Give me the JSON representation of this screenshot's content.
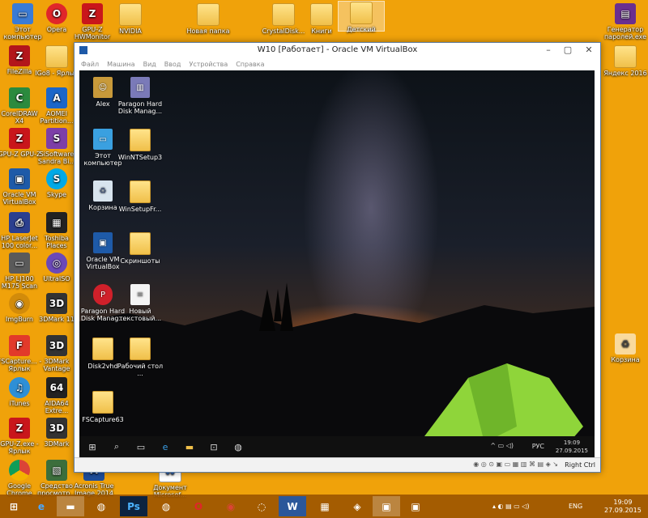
{
  "host_desktop": {
    "icons": [
      {
        "label": "Этот компьютер",
        "icon": "computer-icon"
      },
      {
        "label": "Opera",
        "icon": "opera-icon"
      },
      {
        "label": "GPU-Z HWMonitor",
        "icon": "gpu-z-icon"
      },
      {
        "label": "NVIDIA",
        "icon": "folder-icon"
      },
      {
        "label": "Новая папка",
        "icon": "folder-icon"
      },
      {
        "label": "CrystalDisk...",
        "icon": "folder-icon"
      },
      {
        "label": "Книги",
        "icon": "folder-icon"
      },
      {
        "label": "Детский",
        "icon": "folder-icon"
      },
      {
        "label": "Генератор паролей.exe",
        "icon": "winrar-icon"
      },
      {
        "label": "FileZilla",
        "icon": "filezilla-icon"
      },
      {
        "label": "IGo8 - Ярлык",
        "icon": "folder-icon"
      },
      {
        "label": "Яндекс 2016",
        "icon": "folder-icon"
      },
      {
        "label": "CorelDRAW X4",
        "icon": "coreldraw-icon"
      },
      {
        "label": "AOMEI Partition...",
        "icon": "aomei-icon"
      },
      {
        "label": "GPU-Z GPU-Z",
        "icon": "gpu-z-icon"
      },
      {
        "label": "SiSoftware Sandra Bi...",
        "icon": "sisoftware-icon"
      },
      {
        "label": "Oracle VM VirtualBox",
        "icon": "virtualbox-icon"
      },
      {
        "label": "Skype",
        "icon": "skype-icon"
      },
      {
        "label": "HP LaserJet 100 color...",
        "icon": "printer-icon"
      },
      {
        "label": "Toshiba Places",
        "icon": "toshiba-icon"
      },
      {
        "label": "HP LJ100 M175 Scan",
        "icon": "scanner-icon"
      },
      {
        "label": "UltraISO",
        "icon": "ultraiso-icon"
      },
      {
        "label": "ImgBurn",
        "icon": "imgburn-icon"
      },
      {
        "label": "3DMark 11",
        "icon": "3dmark-icon"
      },
      {
        "label": "FSCapture... - Ярлык",
        "icon": "fscapture-icon"
      },
      {
        "label": "3DMark Vantage",
        "icon": "3dmark-icon"
      },
      {
        "label": "iTunes",
        "icon": "itunes-icon"
      },
      {
        "label": "AIDA64 Extre...",
        "icon": "aida64-icon"
      },
      {
        "label": "GPU-Z.exe - Ярлык",
        "icon": "gpu-z-icon"
      },
      {
        "label": "3DMark",
        "icon": "3dmark-icon"
      },
      {
        "label": "Google Chrome",
        "icon": "chrome-icon"
      },
      {
        "label": "Средство просмотр...",
        "icon": "viewer-icon"
      },
      {
        "label": "Acronis True Image 2014",
        "icon": "acronis-icon"
      },
      {
        "label": "Документ Microsof...",
        "icon": "document-icon"
      },
      {
        "label": "Корзина",
        "icon": "recycle-bin-icon"
      }
    ]
  },
  "vm_window": {
    "title": "W10 [Работает] - Oracle VM VirtualBox",
    "menu": [
      "Файл",
      "Машина",
      "Вид",
      "Ввод",
      "Устройства",
      "Справка"
    ],
    "status_host_key": "Right Ctrl"
  },
  "guest_desktop": {
    "icons": [
      {
        "label": "Alex",
        "icon": "user-folder-icon"
      },
      {
        "label": "Paragon Hard Disk Manag...",
        "icon": "paragon-icon"
      },
      {
        "label": "Этот компьютер",
        "icon": "computer-icon"
      },
      {
        "label": "WinNTSetup3",
        "icon": "folder-icon"
      },
      {
        "label": "Корзина",
        "icon": "recycle-bin-icon"
      },
      {
        "label": "WinSetupFr...",
        "icon": "folder-icon"
      },
      {
        "label": "Oracle VM VirtualBox",
        "icon": "virtualbox-icon"
      },
      {
        "label": "Скриншоты",
        "icon": "folder-icon"
      },
      {
        "label": "Paragon Hard Disk Manag...",
        "icon": "paragon-icon"
      },
      {
        "label": "Новый текстовый...",
        "icon": "text-file-icon"
      },
      {
        "label": "Disk2vhd",
        "icon": "folder-icon"
      },
      {
        "label": "Рабочий стол ...",
        "icon": "desktop-shortcut-icon"
      },
      {
        "label": "FSCapture63",
        "icon": "folder-icon"
      }
    ],
    "taskbar": {
      "lang": "РУС",
      "time": "19:09",
      "date": "27.09.2015"
    }
  },
  "host_taskbar": {
    "lang": "ENG",
    "time": "19:09",
    "date": "27.09.2015"
  }
}
